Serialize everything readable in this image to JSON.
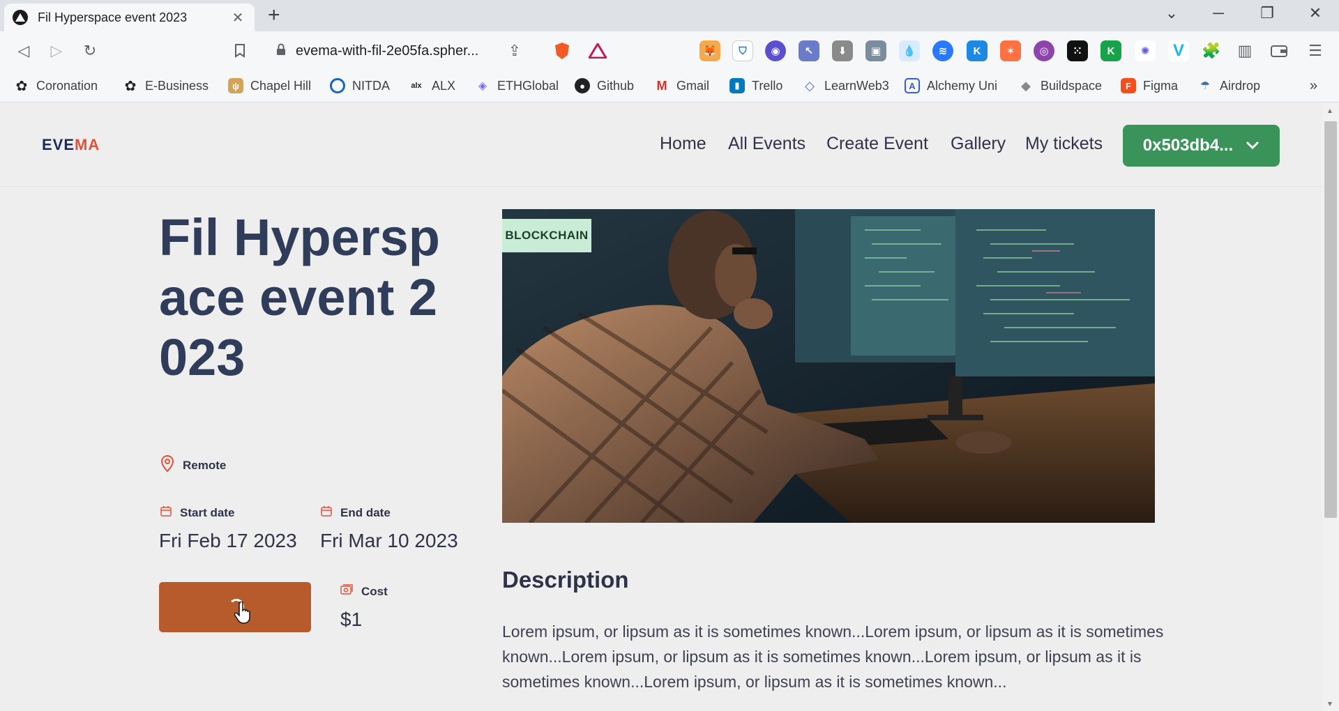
{
  "browser": {
    "tab_title": "Fil Hyperspace event 2023",
    "url": "evema-with-fil-2e05fa.spher...",
    "bookmarks": [
      "Coronation",
      "E-Business",
      "Chapel Hill",
      "NITDA",
      "ALX",
      "ETHGlobal",
      "Github",
      "Gmail",
      "Trello",
      "LearnWeb3",
      "Alchemy Uni",
      "Buildspace",
      "Figma",
      "Airdrop"
    ]
  },
  "site": {
    "logo_part1": "EVE",
    "logo_part2": "MA",
    "nav": [
      "Home",
      "All Events",
      "Create Event",
      "Gallery",
      "My tickets"
    ],
    "wallet": "0x503db4..."
  },
  "event": {
    "title": "Fil Hyperspace event 2023",
    "location": "Remote",
    "start_label": "Start date",
    "start_value": "Fri Feb 17 2023",
    "end_label": "End date",
    "end_value": "Fri Mar 10 2023",
    "cost_label": "Cost",
    "cost_value": "$1",
    "badge": "BLOCKCHAIN",
    "description_title": "Description",
    "description": "Lorem ipsum, or lipsum as it is sometimes known...Lorem ipsum, or lipsum as it is sometimes known...Lorem ipsum, or lipsum as it is sometimes known...Lorem ipsum, or lipsum as it is sometimes known...Lorem ipsum, or lipsum as it is sometimes known..."
  },
  "colors": {
    "accent_green": "#3a9459",
    "buy_button": "#b75a2c",
    "title_text": "#2f3d5a",
    "logo_accent": "#e0513a"
  }
}
